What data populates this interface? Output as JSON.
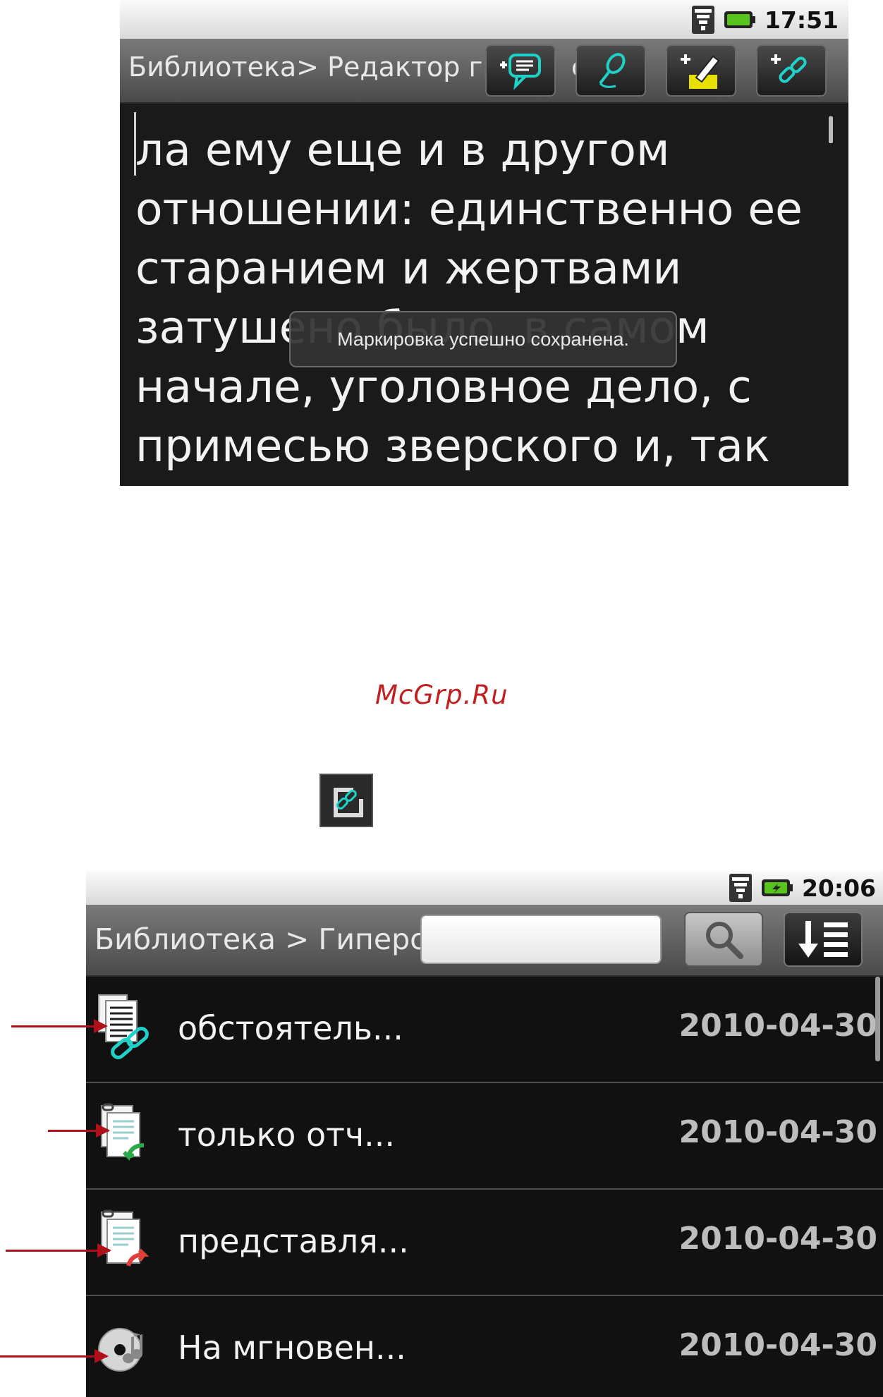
{
  "screen1": {
    "status_time": "17:51",
    "title": "Библиотека> Редактор ги",
    "title_overflow": "с",
    "toolbar": [
      {
        "icon": "add-comment-icon"
      },
      {
        "icon": "voice-note-icon"
      },
      {
        "icon": "add-highlight-icon"
      },
      {
        "icon": "add-hyperlink-icon"
      }
    ],
    "reader_lines": [
      "ла ему еще и в другом",
      "отношении: единственно ее",
      "старанием и жертвами",
      "затушено было, в самом",
      "начале, уголовное дело, с",
      "примесью зверского и, так"
    ],
    "toast": "Маркировка успешно сохранена."
  },
  "watermark": "McGrp.Ru",
  "hyperlink_button_icon": "hyperlink-edit-icon",
  "screen2": {
    "status_time": "20:06",
    "title": "Библиотека > Гиперс",
    "search": {
      "value": "",
      "placeholder": ""
    },
    "search_icon": "search-icon",
    "sort_icon": "sort-icon",
    "items": [
      {
        "icon": "hyperlink-document-icon",
        "name": "обстоятель...",
        "date": "2010-04-30"
      },
      {
        "icon": "document-back-link-icon",
        "name": "только отч...",
        "date": "2010-04-30"
      },
      {
        "icon": "document-forward-link-icon",
        "name": "представля...",
        "date": "2010-04-30"
      },
      {
        "icon": "audio-disc-icon",
        "name": "На мгновен...",
        "date": "2010-04-30"
      }
    ]
  },
  "colors": {
    "accent": "#1fd1c8",
    "arrow": "#b0101a",
    "watermark": "#c02020"
  }
}
